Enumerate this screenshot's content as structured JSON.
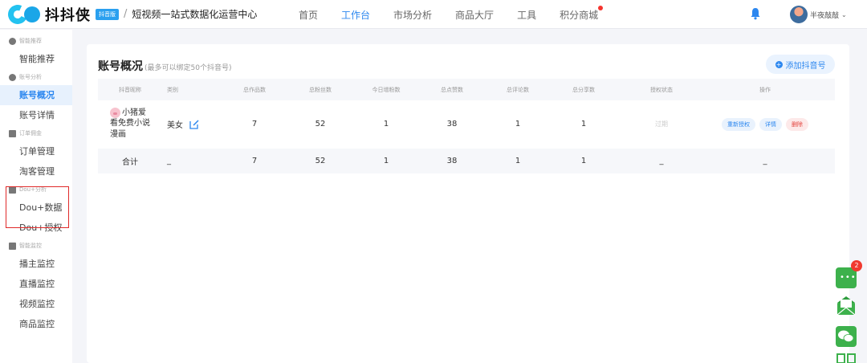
{
  "header": {
    "logo_text": "抖抖侠",
    "badge": "抖音版",
    "separator": "/",
    "slogan": "短视频一站式数据化运营中心",
    "nav": [
      {
        "label": "首页",
        "active": false
      },
      {
        "label": "工作台",
        "active": true
      },
      {
        "label": "市场分析",
        "active": false
      },
      {
        "label": "商品大厅",
        "active": false
      },
      {
        "label": "工具",
        "active": false
      },
      {
        "label": "积分商城",
        "active": false,
        "dot": true
      }
    ],
    "username": "半夜敲敲",
    "accent_color": "#2c87ef"
  },
  "sidebar": {
    "sections": [
      {
        "title": "智能推荐",
        "items": [
          "智能推荐"
        ]
      },
      {
        "title": "账号分析",
        "items": [
          "账号概况",
          "账号详情"
        ]
      },
      {
        "title": "订单佣金",
        "items": [
          "订单管理",
          "淘客管理"
        ]
      },
      {
        "title": "Dou+分析",
        "items": [
          "Dou+数据",
          "Dou+授权"
        ]
      },
      {
        "title": "智能监控",
        "items": [
          "播主监控",
          "直播监控",
          "视频监控",
          "商品监控"
        ]
      }
    ],
    "active_item": "账号概况"
  },
  "card": {
    "title": "账号概况",
    "subtitle": "(最多可以绑定50个抖音号)",
    "add_button": "添加抖音号",
    "columns": [
      "抖音昵称",
      "类别",
      "总作品数",
      "总粉丝数",
      "今日增粉数",
      "总点赞数",
      "总评论数",
      "总分享数",
      "授权状态",
      "操作"
    ],
    "rows": [
      {
        "name_line1": "小猪爱",
        "name_line2": "看免费小说",
        "name_line3": "漫画",
        "category": "美女",
        "works": "7",
        "fans": "52",
        "today_fans": "1",
        "likes": "38",
        "comments": "1",
        "shares": "1",
        "auth_status": "过期",
        "ops": [
          "重新授权",
          "详情",
          "删除"
        ]
      }
    ],
    "total": {
      "label": "合计",
      "category": "_",
      "works": "7",
      "fans": "52",
      "today_fans": "1",
      "likes": "38",
      "comments": "1",
      "shares": "1",
      "auth_status": "_",
      "ops": "_"
    }
  },
  "floating": {
    "chat_badge": "2"
  }
}
